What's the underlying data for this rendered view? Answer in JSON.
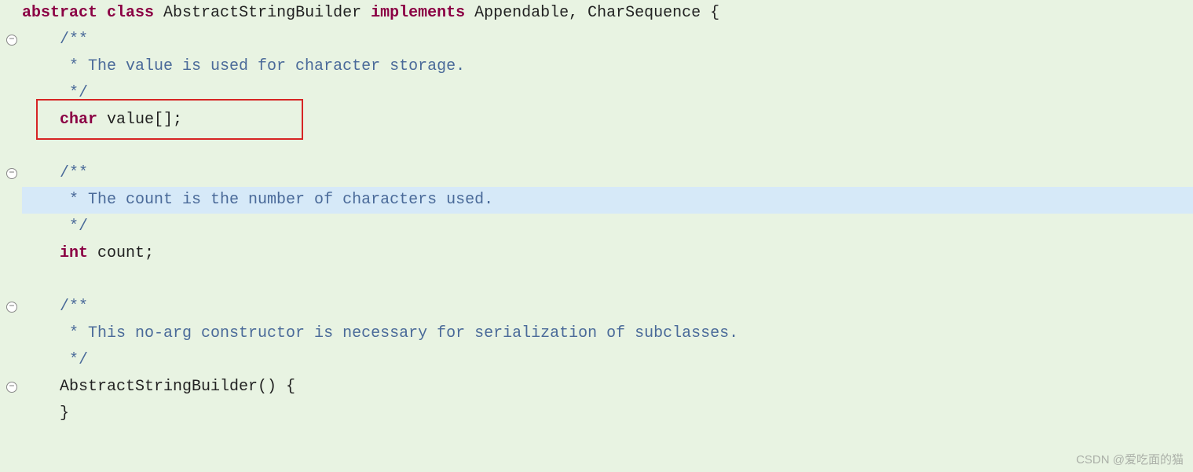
{
  "code": {
    "l1_kw1": "abstract",
    "l1_kw2": "class",
    "l1_name": " AbstractStringBuilder ",
    "l1_kw3": "implements",
    "l1_rest": " Appendable, CharSequence {",
    "l2": "    /**",
    "l3": "     * The value is used for character storage.",
    "l4": "     */",
    "l5_kw": "    char",
    "l5_rest": " value[];",
    "l6": "",
    "l7": "    /**",
    "l8": "     * The count is the number of characters used.",
    "l9": "     */",
    "l10_kw": "    int",
    "l10_rest": " count;",
    "l11": "",
    "l12": "    /**",
    "l13": "     * This no-arg constructor is necessary for serialization of subclasses.",
    "l14": "     */",
    "l15": "    AbstractStringBuilder() {",
    "l16": "    }"
  },
  "watermark": "CSDN @爱吃面的猫",
  "fold_glyph": "−"
}
